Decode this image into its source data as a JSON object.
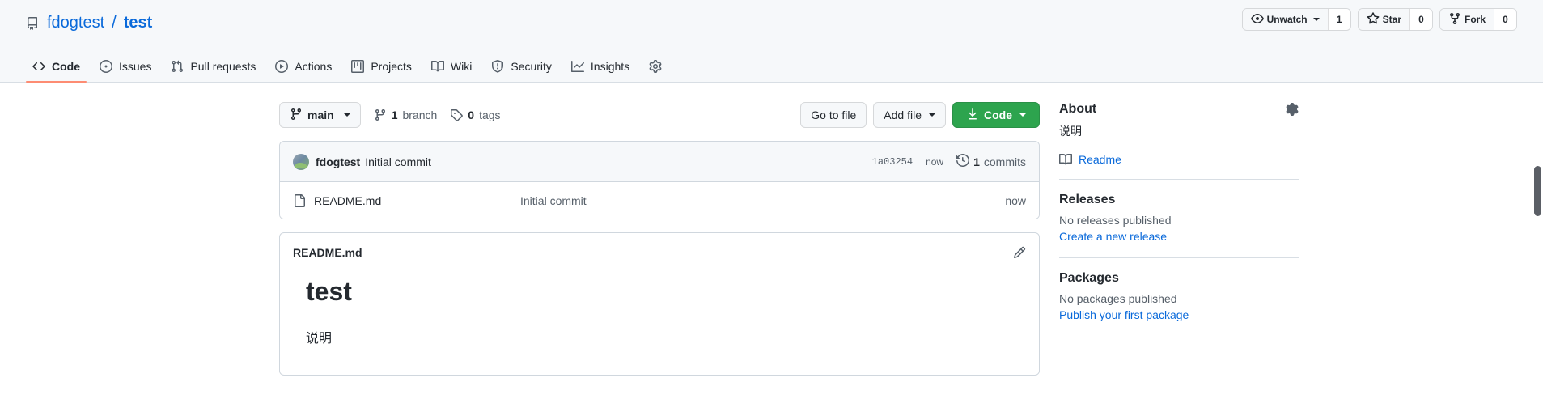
{
  "repo": {
    "owner": "fdogtest",
    "separator": "/",
    "name": "test",
    "repo_icon": "repo-icon"
  },
  "header_actions": {
    "watch": {
      "label": "Unwatch",
      "count": "1",
      "icon": "eye-icon"
    },
    "star": {
      "label": "Star",
      "count": "0",
      "icon": "star-icon"
    },
    "fork": {
      "label": "Fork",
      "count": "0",
      "icon": "fork-icon"
    }
  },
  "nav": {
    "items": [
      {
        "label": "Code",
        "icon": "code-icon",
        "selected": true
      },
      {
        "label": "Issues",
        "icon": "issue-opened-icon",
        "selected": false
      },
      {
        "label": "Pull requests",
        "icon": "git-pull-request-icon",
        "selected": false
      },
      {
        "label": "Actions",
        "icon": "play-icon",
        "selected": false
      },
      {
        "label": "Projects",
        "icon": "project-icon",
        "selected": false
      },
      {
        "label": "Wiki",
        "icon": "book-icon",
        "selected": false
      },
      {
        "label": "Security",
        "icon": "shield-icon",
        "selected": false
      },
      {
        "label": "Insights",
        "icon": "graph-icon",
        "selected": false
      }
    ]
  },
  "file_nav": {
    "branch_label": "main",
    "branch_icon": "git-branch-icon",
    "branches_count": "1",
    "branches_label": "branch",
    "tags_count": "0",
    "tags_label": "tags",
    "tags_icon": "tag-icon",
    "go_to_file": "Go to file",
    "add_file": "Add file",
    "code_button": "Code",
    "code_icon": "download-icon"
  },
  "latest_commit": {
    "author": "fdogtest",
    "message": "Initial commit",
    "sha": "1a03254",
    "time": "now",
    "commits_count": "1",
    "commits_label": "commits",
    "history_icon": "history-icon"
  },
  "files": {
    "rows": [
      {
        "name": "README.md",
        "icon": "file-icon",
        "message": "Initial commit",
        "age": "now"
      }
    ]
  },
  "readme": {
    "title": "README.md",
    "edit_icon": "pencil-icon",
    "heading": "test",
    "paragraph": "说明"
  },
  "sidebar": {
    "about": {
      "title": "About",
      "gear_icon": "gear-icon",
      "description": "说明",
      "readme_link": "Readme",
      "readme_icon": "book-icon"
    },
    "releases": {
      "title": "Releases",
      "empty_note": "No releases published",
      "cta": "Create a new release"
    },
    "packages": {
      "title": "Packages",
      "empty_note": "No packages published",
      "cta": "Publish your first package"
    }
  },
  "colors": {
    "accent": "#0969da",
    "tab_underline": "#fd8c73",
    "primary_button": "#2da44e",
    "header_bg": "#f6f8fa",
    "border": "#d0d7de",
    "muted_text": "#57606a"
  }
}
